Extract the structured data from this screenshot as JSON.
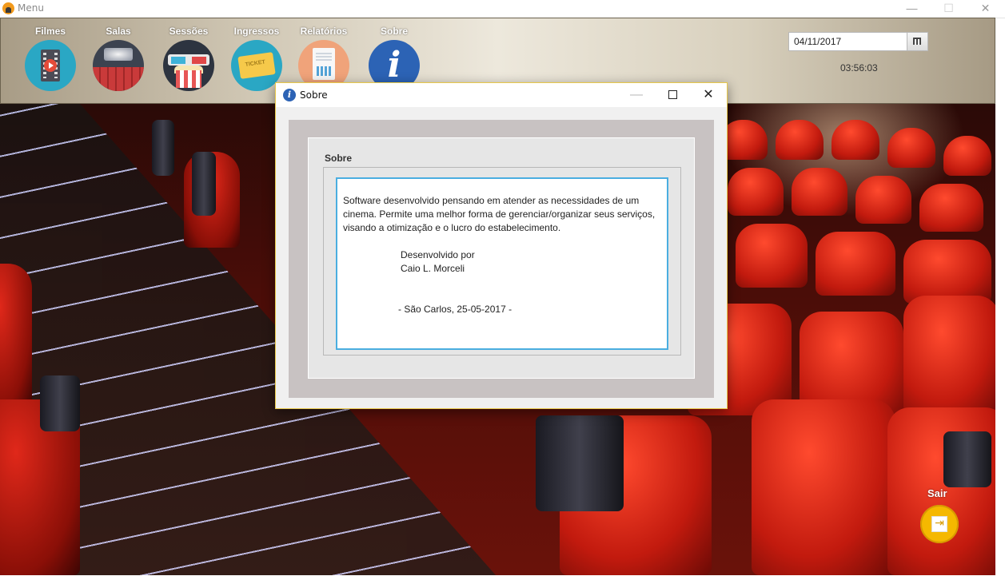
{
  "window": {
    "title": "Menu",
    "minimize_icon": "—",
    "maximize_icon": "☐",
    "close_icon": "✕"
  },
  "toolbar": {
    "items": [
      {
        "label": "Filmes",
        "icon": "film-play-icon"
      },
      {
        "label": "Salas",
        "icon": "cinema-room-icon"
      },
      {
        "label": "Sessões",
        "icon": "3d-glasses-popcorn-icon"
      },
      {
        "label": "Ingressos",
        "icon": "ticket-icon"
      },
      {
        "label": "Relatórios",
        "icon": "report-document-icon"
      },
      {
        "label": "Sobre",
        "icon": "info-icon"
      }
    ],
    "ticket_text": "TICKET",
    "info_glyph": "i"
  },
  "date_picker": {
    "value": "04/11/2017",
    "icon": "calendar-icon"
  },
  "clock": "03:56:03",
  "dialog": {
    "title": "Sobre",
    "icon_glyph": "i",
    "minimize_icon": "—",
    "close_icon": "✕",
    "group_title": "Sobre",
    "text": {
      "line1": "Software  desenvolvido  pensando  em  atender as  necessidades de um",
      "line2": "cinema. Permite uma melhor forma de gerenciar/organizar seus serviços,",
      "line3": "visando a otimização e o lucro do estabelecimento.",
      "dev_label": "Desenvolvido por",
      "dev_name": "Caio L. Morceli",
      "place_date": "- São Carlos, 25-05-2017 -"
    }
  },
  "exit": {
    "label": "Sair",
    "icon_glyph": "⇥"
  },
  "colors": {
    "exit_button": "#f5b800",
    "dialog_border": "#e8c84a",
    "text_focus_border": "#4aaee0"
  }
}
